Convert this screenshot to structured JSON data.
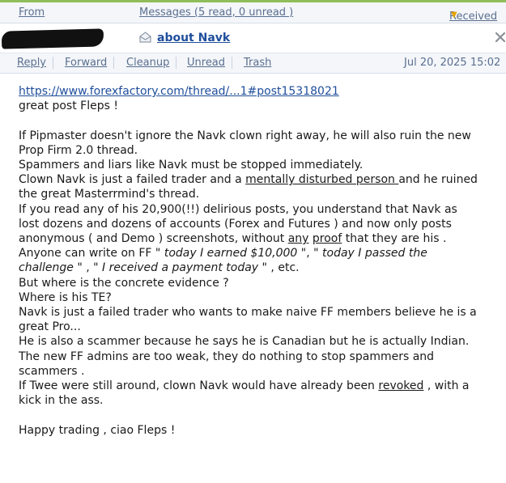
{
  "header": {
    "from_label": "From",
    "messages_label": "Messages (5 read, 0 unread )",
    "received_label": "Received"
  },
  "message": {
    "subject": "about Navk",
    "actions": [
      "Reply",
      "Forward",
      "Cleanup",
      "Unread",
      "Trash"
    ],
    "date": "Jul 20, 2025 15:02"
  },
  "body": {
    "link": "https://www.forexfactory.com/thread/...1#post15318021",
    "l1": "great post Fleps !",
    "l2": "If Pipmaster doesn't ignore the Navk clown right away, he will also ruin the new",
    "l3": "Prop Firm 2.0 thread.",
    "l4": "Spammers and liars like Navk must be stopped immediately.",
    "l5a": "Clown Navk is just a failed trader and a ",
    "l5b": "mentally disturbed person ",
    "l5c": "and he ruined",
    "l6": "the great Masterrmind's thread.",
    "l7": "If you read any of his 20,900(!!) delirious posts, you understand that Navk as",
    "l8": "lost dozens and dozens of accounts (Forex and Futures ) and now only posts",
    "l9a": "anonymous ( and Demo ) screenshots, without ",
    "l9b": "any",
    "l9c": " ",
    "l9d": "proof",
    "l9e": " that they are his .",
    "l10a": "Anyone can write on FF \"",
    "l10b": " today I earned $10,000 \"",
    "l10c": ", \"",
    "l10d": " today I passed the",
    "l11a": "challenge \"",
    "l11b": " , \"",
    "l11c": " I received a payment today \"",
    "l11d": " , etc.",
    "l12": "But where is the concrete evidence ?",
    "l13": "Where is his TE?",
    "l14": "Navk is just a failed trader who wants to make naive FF members believe he is a",
    "l15": "great Pro...",
    "l16": "He is also a scammer because he says he is Canadian but he is actually Indian.",
    "l17": "The new FF admins are too weak, they do nothing to stop spammers and",
    "l18": "scammers .",
    "l19a": "If Twee were still around, clown Navk would have already been ",
    "l19b": "revoked",
    "l19c": " , with a",
    "l20": "kick in the ass.",
    "l21": "Happy trading , ciao Fleps !"
  },
  "colors": {
    "link": "#1f4e9c",
    "header_bg": "#f4f6fa",
    "header_text": "#5a6f8e",
    "accent_bar": "#8fbd5a"
  }
}
